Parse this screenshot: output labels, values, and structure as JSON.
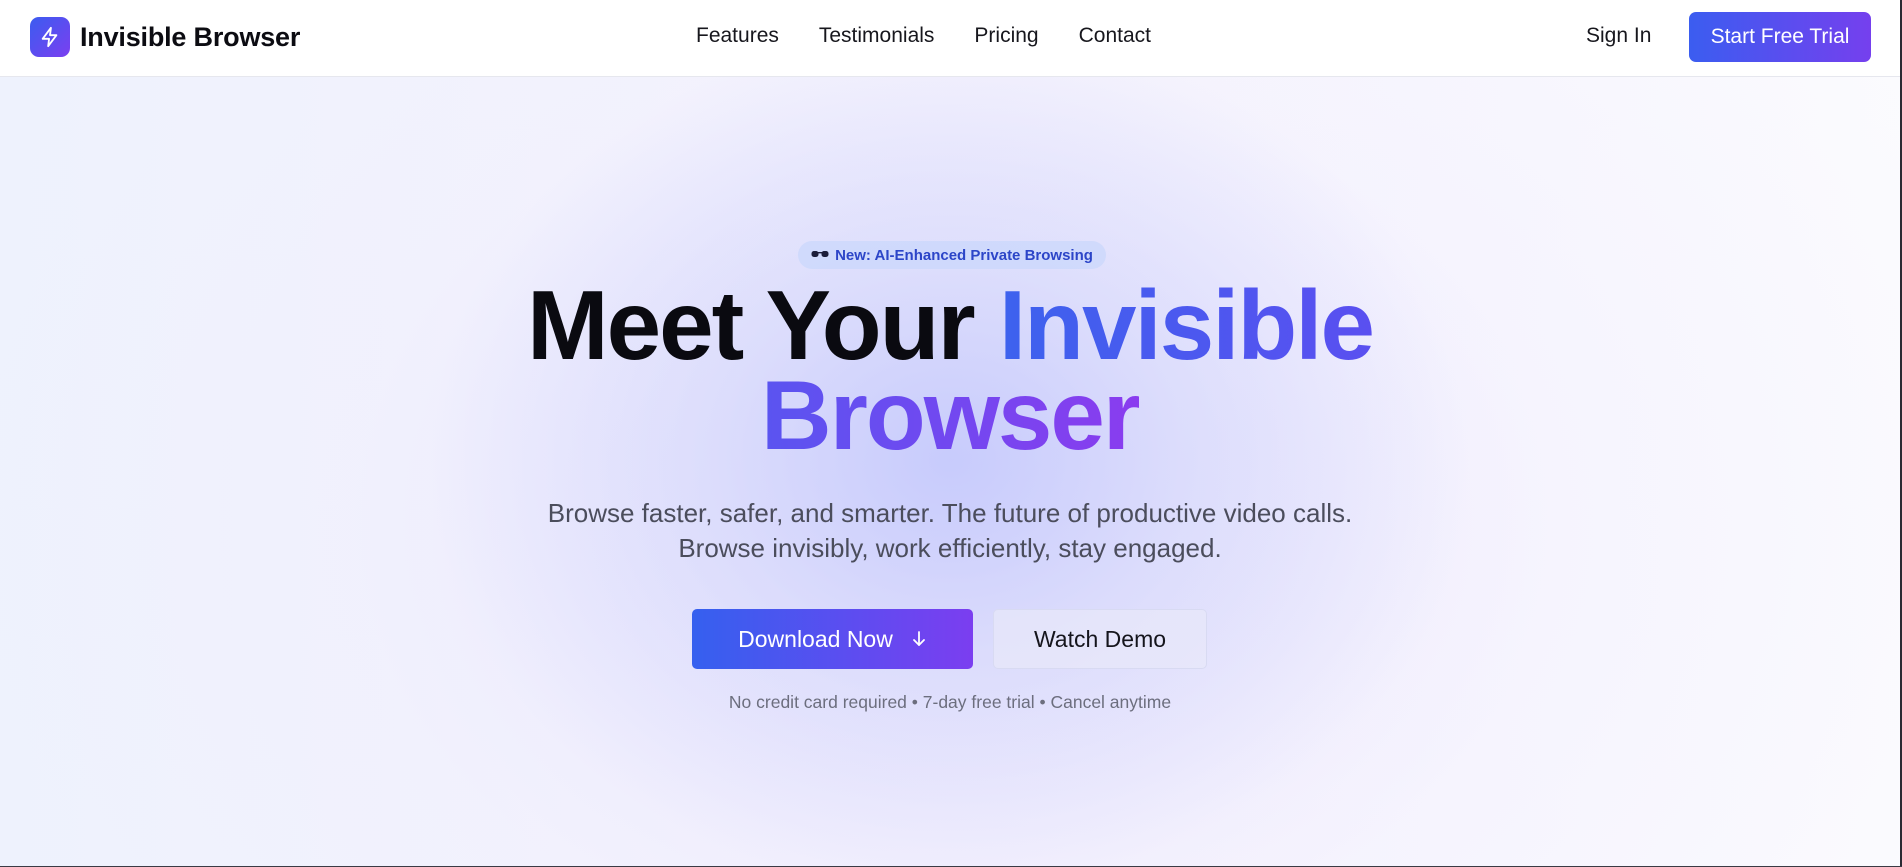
{
  "nav": {
    "brand": "Invisible Browser",
    "brand_icon": "lightning-bolt-icon",
    "links": [
      "Features",
      "Testimonials",
      "Pricing",
      "Contact"
    ],
    "sign_in": "Sign In",
    "cta": "Start Free Trial"
  },
  "hero": {
    "badge_icon": "sunglasses-icon",
    "badge_text": "New: AI-Enhanced Private Browsing",
    "title_part1": "Meet Your ",
    "title_part2": "Invisible",
    "title_part3": "Browser",
    "subtitle_line1": "Browse faster, safer, and smarter. The future of productive video calls.",
    "subtitle_line2": "Browse invisibly, work efficiently, stay engaged.",
    "download_label": "Download Now",
    "download_icon": "arrow-down-icon",
    "demo_label": "Watch Demo",
    "fineprint": "No credit card required • 7-day free trial • Cancel anytime"
  },
  "colors": {
    "accent_blue": "#3b5df0",
    "accent_purple": "#7b3ef0",
    "badge_text": "#2c45c8"
  }
}
